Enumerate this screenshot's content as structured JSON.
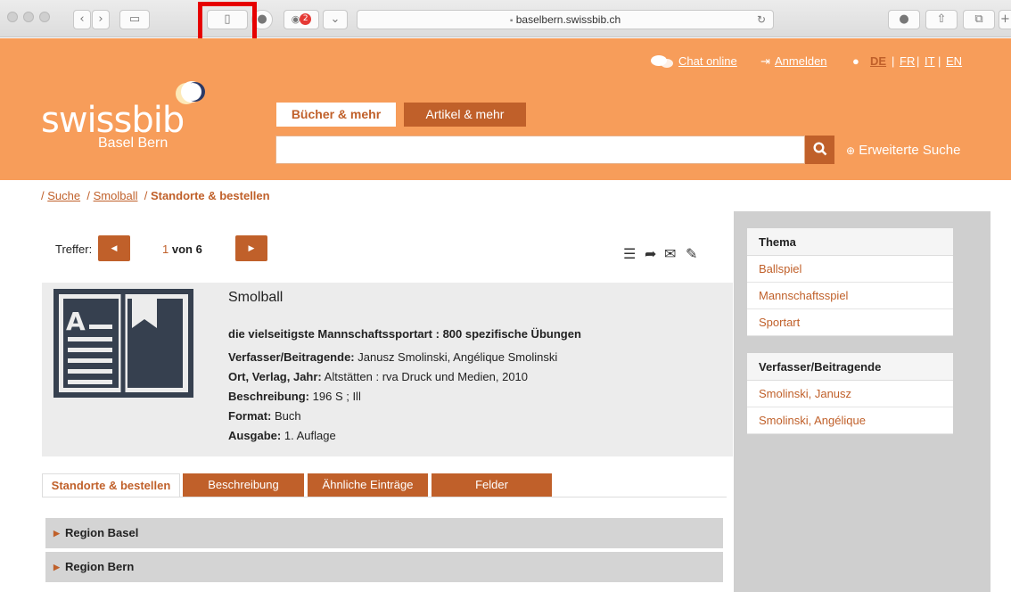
{
  "browser": {
    "url": "baselbern.swissbib.ch",
    "notification_count": "2"
  },
  "header": {
    "chat_label": "Chat online",
    "login_label": "Anmelden",
    "lang_active": "DE",
    "lang_sep": "|",
    "lang_fr": "FR",
    "lang_it": "IT",
    "lang_en": "EN",
    "logo_text": "swissbib",
    "logo_sub": "Basel Bern",
    "tab_books": "Bücher & mehr",
    "tab_articles": "Artikel & mehr",
    "search_value": "",
    "advanced_search": "Erweiterte Suche"
  },
  "breadcrumb": {
    "sep": "/",
    "search": "Suche",
    "item": "Smolball",
    "current": "Standorte & bestellen"
  },
  "pager": {
    "label": "Treffer:",
    "current": "1",
    "of_total": " von 6"
  },
  "record": {
    "title": "Smolball",
    "subtitle": "die vielseitigste Mannschaftssportart : 800 spezifische Übungen",
    "authors_label": "Verfasser/Beitragende:",
    "authors": "Janusz Smolinski, Angélique Smolinski",
    "publisher_label": "Ort, Verlag, Jahr:",
    "publisher": "Altstätten : rva Druck und Medien,   2010",
    "description_label": "Beschreibung:",
    "description": "196 S ; Ill",
    "format_label": "Format:",
    "format": "Buch",
    "edition_label": "Ausgabe:",
    "edition": "1. Auflage"
  },
  "tabs": [
    "Standorte & bestellen",
    "Beschreibung",
    "Ähnliche Einträge",
    "Felder"
  ],
  "regions": [
    "Region Basel",
    "Region Bern"
  ],
  "sidebar": {
    "topic_head": "Thema",
    "topics": [
      "Ballspiel",
      "Mannschaftsspiel",
      "Sportart"
    ],
    "authors_head": "Verfasser/Beitragende",
    "authors": [
      "Smolinski, Janusz",
      "Smolinski, Angélique"
    ]
  },
  "colors": {
    "header_orange": "#f79d5a",
    "accent": "#c0602a",
    "highlight_red": "#e60000"
  }
}
